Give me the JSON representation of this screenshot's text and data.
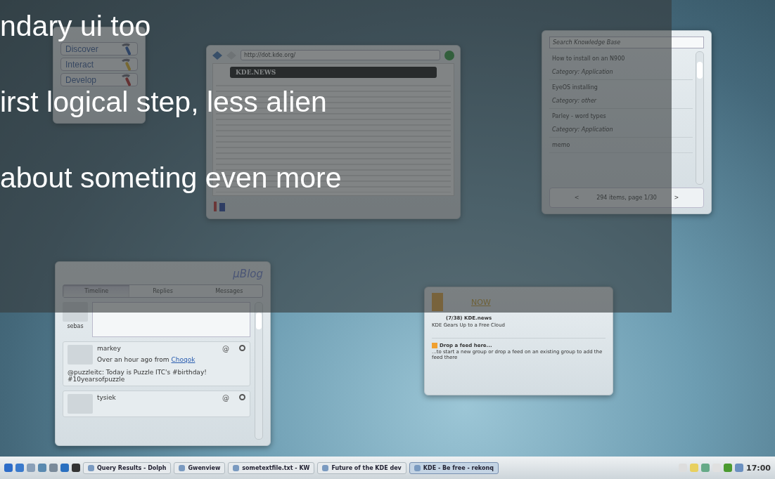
{
  "overlay": {
    "lines": [
      "ndary ui too",
      "irst logical step, less alien",
      "about someting even more"
    ]
  },
  "launcher_widget": {
    "buttons": [
      "Discover",
      "Interact",
      "Develop"
    ]
  },
  "browser_widget": {
    "url": "http://dot.kde.org/",
    "site_title": "KDE.NEWS"
  },
  "knowledge_widget": {
    "search_placeholder": "Search Knowledge Base",
    "items": [
      {
        "title": "How to install on an N900",
        "category": "Category: Application"
      },
      {
        "title": "EyeOS installing",
        "category": "Category: other"
      },
      {
        "title": "Parley - word types",
        "category": "Category: Application"
      },
      {
        "title": "memo"
      }
    ],
    "pager": {
      "prev": "<",
      "status": "294 items, page 1/30",
      "next": ">"
    }
  },
  "microblog_widget": {
    "logo": "µBlog",
    "tabs": [
      {
        "label": "Timeline",
        "selected": true
      },
      {
        "label": "Replies",
        "selected": false
      },
      {
        "label": "Messages",
        "selected": false
      }
    ],
    "user": "sebas",
    "posts": [
      {
        "author": "markey",
        "meta": "Over an hour ago from",
        "source": "Choqok",
        "reply": "@",
        "text": "@puzzleitc: Today is Puzzle ITC's #birthday! #10yearsofpuzzle"
      },
      {
        "author": "tysiek",
        "reply": "@"
      }
    ]
  },
  "news_widget": {
    "title": "NOW",
    "feed_title": "(7/38) KDE.news",
    "headline": "KDE Gears Up to a Free Cloud",
    "drop_title": "Drop a feed here...",
    "drop_text": "...to start a new group or drop a feed on an existing group to add the feed there"
  },
  "taskbar": {
    "tasks": [
      {
        "label": "Query Results - Dolph",
        "selected": false
      },
      {
        "label": "Gwenview",
        "selected": false
      },
      {
        "label": "sometextfile.txt - KW",
        "selected": false
      },
      {
        "label": "Future of the KDE dev",
        "selected": false
      },
      {
        "label": "KDE - Be free - rekonq",
        "selected": true
      }
    ],
    "clock": "17:00"
  }
}
